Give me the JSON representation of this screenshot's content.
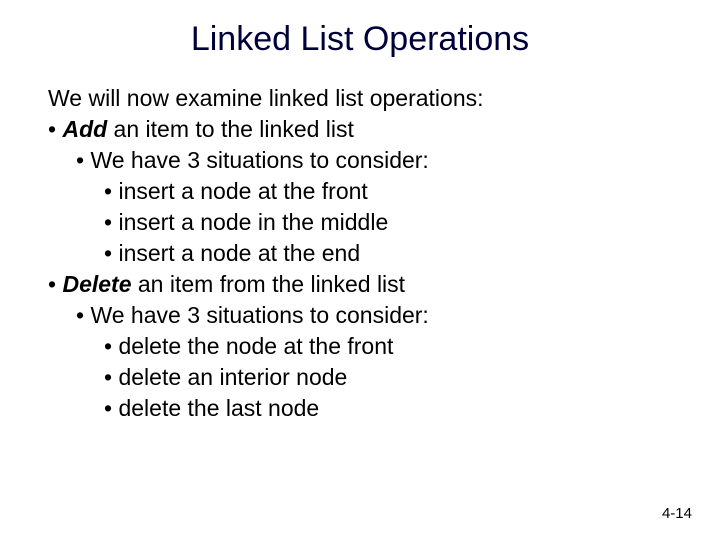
{
  "title": "Linked List Operations",
  "intro": "We will now examine linked list operations:",
  "add": {
    "label": "Add",
    "rest": " an item to the linked list",
    "sub": "We have 3 situations to consider:",
    "i1a": "insert a node ",
    "i1b": "at the front",
    "i2a": "insert a node ",
    "i2b": "in the middle",
    "i3a": "insert a node ",
    "i3b": "at the end"
  },
  "del": {
    "label": "Delete",
    "rest": " an item from the linked list",
    "sub": "We have 3 situations to consider:",
    "d1a": "delete the node ",
    "d1b": "at the front",
    "d2a": "delete an ",
    "d2b": "interior",
    "d2c": " node",
    "d3a": "delete the ",
    "d3b": "last",
    "d3c": " node"
  },
  "pagenum": "4-14"
}
